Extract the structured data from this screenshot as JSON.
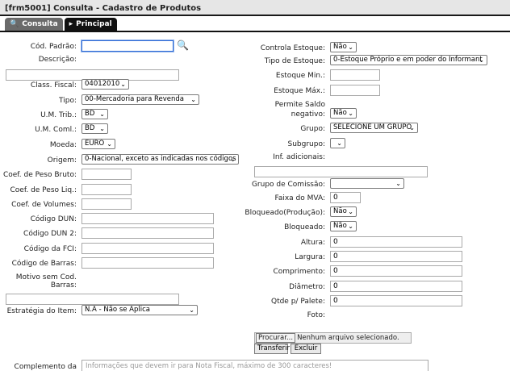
{
  "window_title": "[frm5001] Consulta - Cadastro de Produtos",
  "tabs": {
    "consulta": "Consulta",
    "principal": "Principal"
  },
  "left": {
    "cod_padrao": {
      "label": "Cód. Padrão:",
      "value": ""
    },
    "descricao": {
      "label": "Descrição:",
      "value": ""
    },
    "class_fiscal": {
      "label": "Class. Fiscal:",
      "value": "04012010"
    },
    "tipo": {
      "label": "Tipo:",
      "value": "00-Mercadoria para Revenda"
    },
    "um_trib": {
      "label": "U.M. Trib.:",
      "value": "BD"
    },
    "um_coml": {
      "label": "U.M. Coml.:",
      "value": "BD"
    },
    "moeda": {
      "label": "Moeda:",
      "value": "EURO"
    },
    "origem": {
      "label": "Origem:",
      "value": "0-Nacional, exceto as indicadas nos códigos"
    },
    "peso_bruto": {
      "label": "Coef. de Peso Bruto:",
      "value": ""
    },
    "peso_liq": {
      "label": "Coef. de Peso Liq.:",
      "value": ""
    },
    "volumes": {
      "label": "Coef. de Volumes:",
      "value": ""
    },
    "dun": {
      "label": "Código DUN:",
      "value": ""
    },
    "dun2": {
      "label": "Código DUN 2:",
      "value": ""
    },
    "fci": {
      "label": "Código da FCI:",
      "value": ""
    },
    "barras": {
      "label": "Código de Barras:",
      "value": ""
    },
    "motivo": {
      "label1": "Motivo sem Cod.",
      "label2": "Barras:",
      "value": ""
    },
    "estrategia": {
      "label": "Estratégia do Item:",
      "value": "N.A - Não se Aplica"
    },
    "complemento": {
      "label": "Complemento da",
      "placeholder": "Informações que devem ir para Nota Fiscal, máximo de 300 caracteres!"
    }
  },
  "right": {
    "controla_estoque": {
      "label": "Controla Estoque:",
      "value": "Não"
    },
    "tipo_estoque": {
      "label": "Tipo de Estoque:",
      "value": "0-Estoque Próprio e em poder do Informant"
    },
    "estoque_min": {
      "label": "Estoque Min.:",
      "value": ""
    },
    "estoque_max": {
      "label": "Estoque Máx.:",
      "value": ""
    },
    "saldo_neg": {
      "label1": "Permite Saldo",
      "label2": "negativo:",
      "value": "Não"
    },
    "grupo": {
      "label": "Grupo:",
      "value": "SELECIONE UM GRUPO"
    },
    "subgrupo": {
      "label": "Subgrupo:",
      "value": ""
    },
    "inf_adic": {
      "label": "Inf. adicionais:",
      "value": ""
    },
    "grupo_comissao": {
      "label": "Grupo de Comissão:",
      "value": ""
    },
    "faixa_mva": {
      "label": "Faixa do MVA:",
      "value": "0"
    },
    "bloq_prod": {
      "label": "Bloqueado(Produção):",
      "value": "Não"
    },
    "bloqueado": {
      "label": "Bloqueado:",
      "value": "Não"
    },
    "altura": {
      "label": "Altura:",
      "value": "0"
    },
    "largura": {
      "label": "Largura:",
      "value": "0"
    },
    "comprimento": {
      "label": "Comprimento:",
      "value": "0"
    },
    "diametro": {
      "label": "Diâmetro:",
      "value": "0"
    },
    "qtde_palete": {
      "label": "Qtde p/ Palete:",
      "value": "0"
    },
    "foto": {
      "label": "Foto:"
    },
    "file": {
      "button": "Procurar...",
      "status": "Nenhum arquivo selecionado."
    },
    "transferir": "Transferir",
    "excluir": "Excluir"
  }
}
